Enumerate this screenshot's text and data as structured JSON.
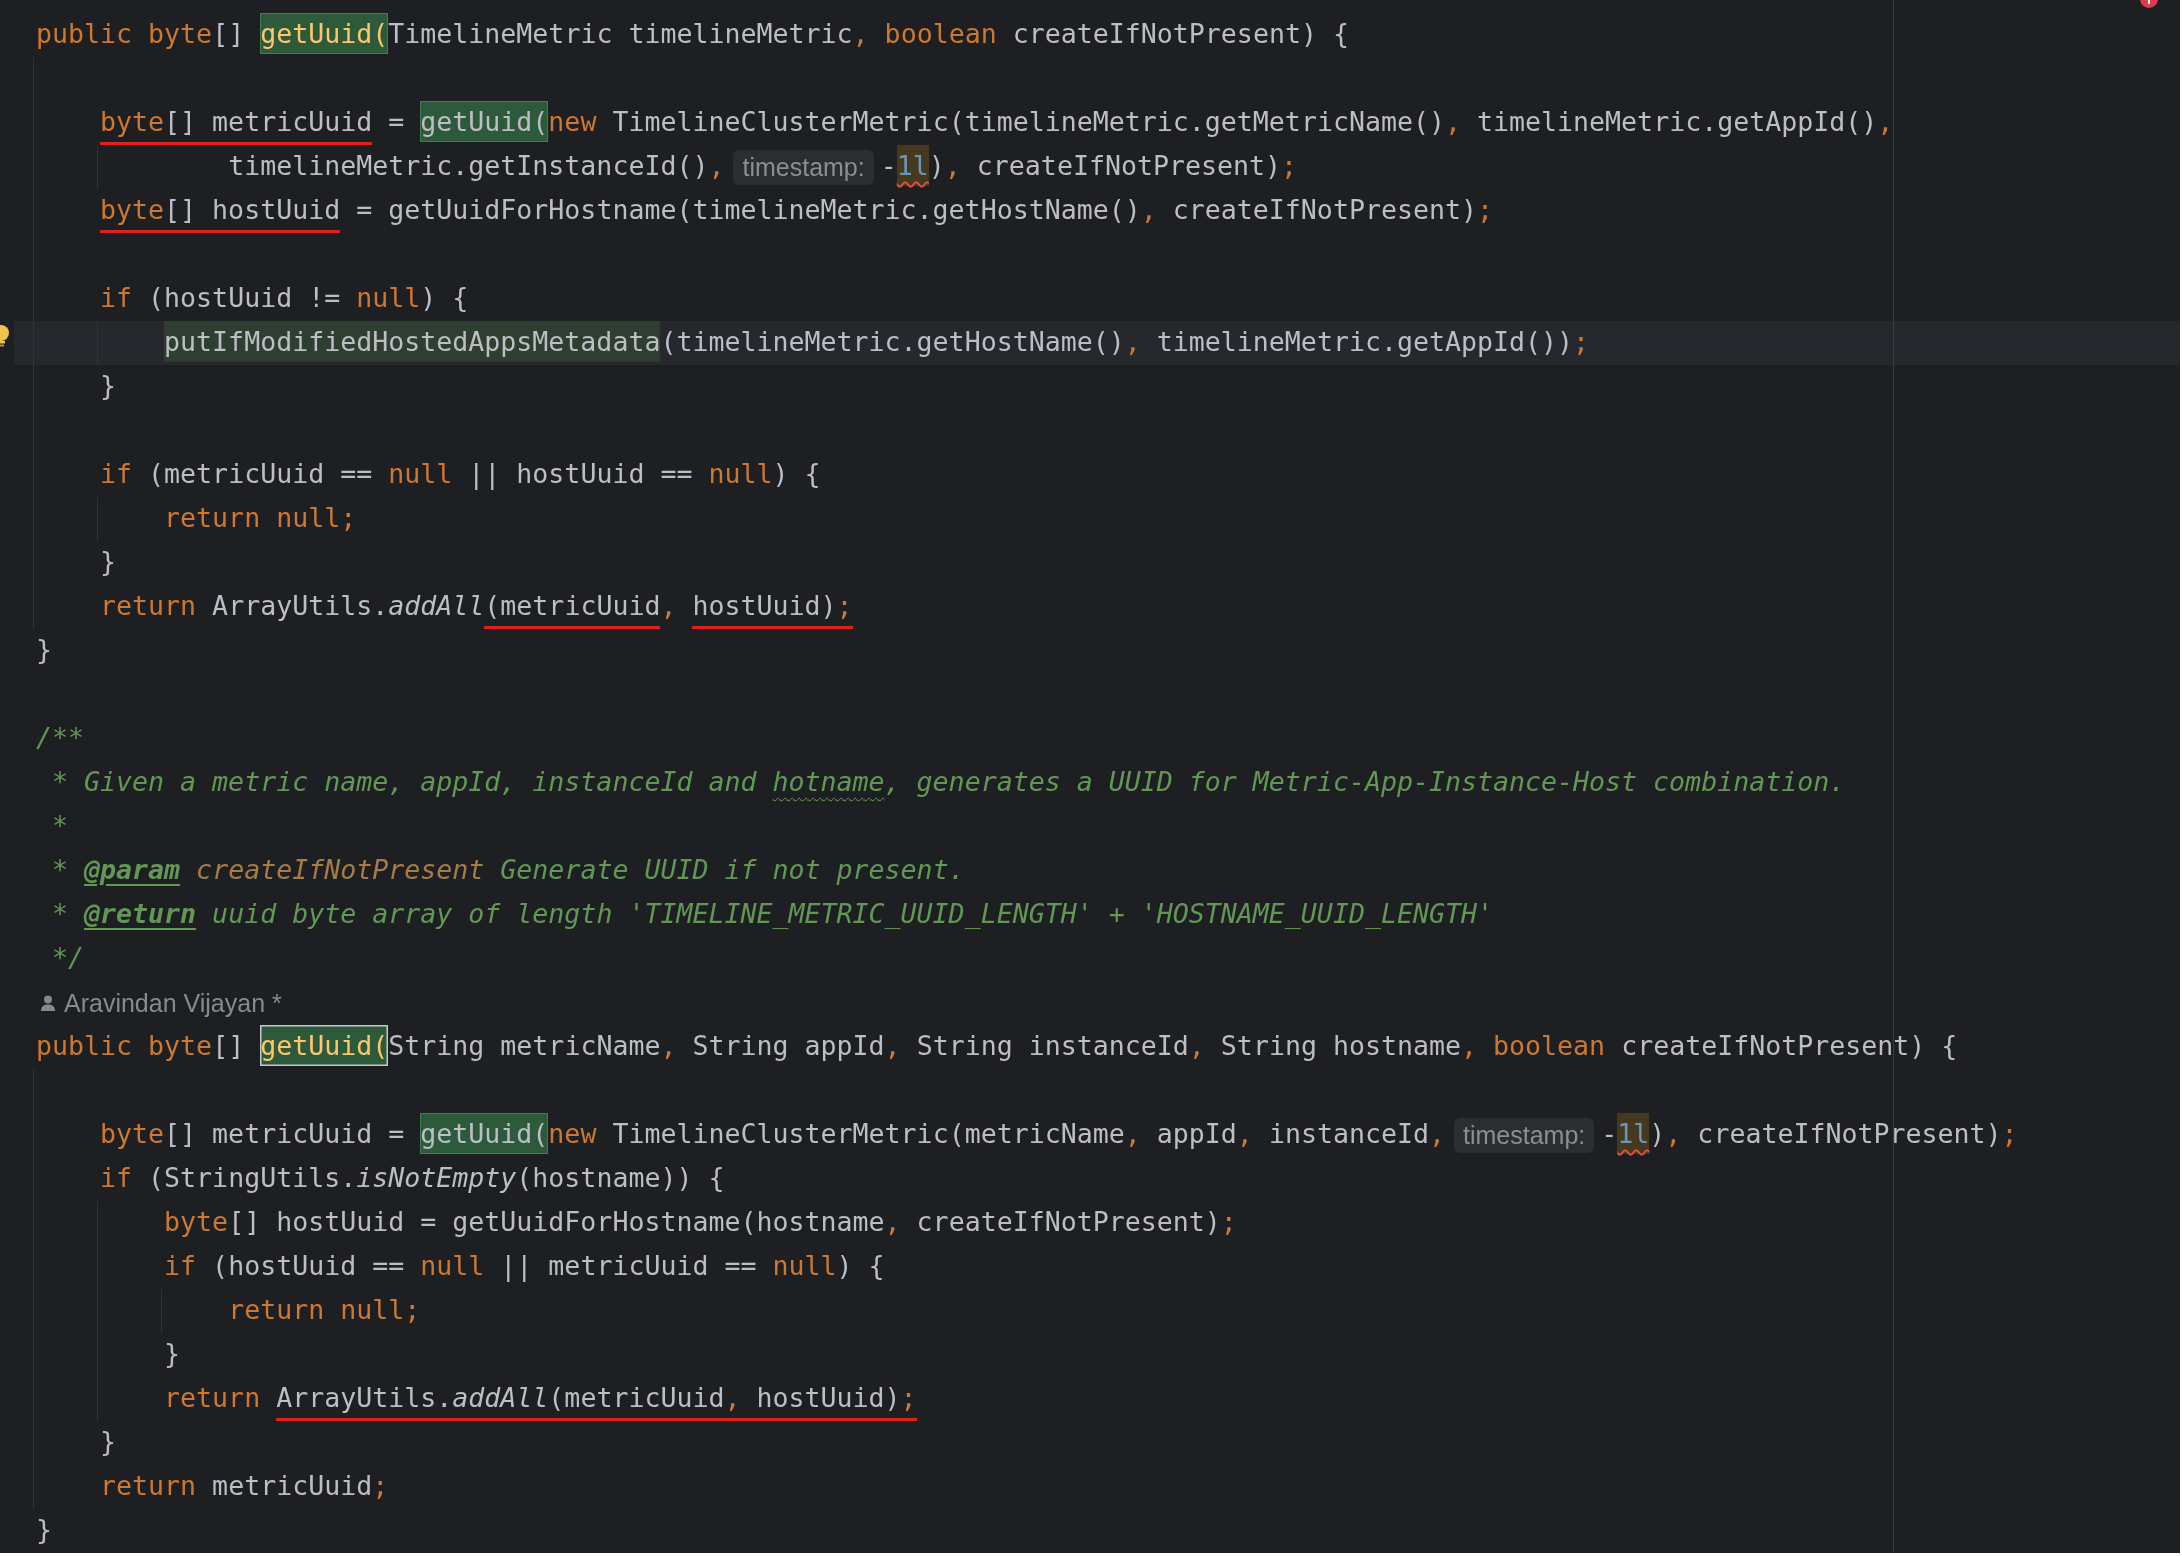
{
  "code_editor": {
    "lines": [
      {
        "kind": "code",
        "current": false,
        "tokens": [
          {
            "kind": "keyword",
            "text": "public byte"
          },
          {
            "kind": "plain",
            "text": "[] "
          },
          {
            "kind": "decl",
            "text": "getUuid(",
            "highlight": {
              "kind": "usage"
            }
          },
          {
            "kind": "plain",
            "text": "TimelineMetric timelineMetric"
          },
          {
            "kind": "punct",
            "text": ","
          },
          {
            "kind": "keyword",
            "text": " boolean"
          },
          {
            "kind": "plain",
            "text": " createIfNotPresent) {"
          }
        ],
        "children": [
          {
            "kind": "blank",
            "current": false
          },
          {
            "kind": "code",
            "current": false,
            "tokens": [
              {
                "kind": "keyword",
                "text": "byte",
                "highlight": {
                  "kind": "annotation"
                }
              },
              {
                "kind": "plain",
                "text": "[] metricUuid",
                "highlight": {
                  "kind": "annotation"
                }
              },
              {
                "kind": "plain",
                "text": " = "
              },
              {
                "kind": "plain",
                "text": "getUuid(",
                "highlight": {
                  "kind": "usage"
                }
              },
              {
                "kind": "keyword",
                "text": "new"
              },
              {
                "kind": "plain",
                "text": " TimelineClusterMetric(timelineMetric.getMetricName()"
              },
              {
                "kind": "punct",
                "text": ","
              },
              {
                "kind": "plain",
                "text": " timelineMetric.getAppId()"
              },
              {
                "kind": "punct",
                "text": ","
              }
            ],
            "children": [
              {
                "kind": "continuation",
                "current": false,
                "tokens": [
                  {
                    "kind": "plain",
                    "text": "timelineMetric.getInstanceId()"
                  },
                  {
                    "kind": "punct",
                    "text": ","
                  },
                  {
                    "kind": "hint",
                    "text": "timestamp:"
                  },
                  {
                    "kind": "plain",
                    "text": "-"
                  },
                  {
                    "kind": "number",
                    "text": "1l",
                    "highlight": {
                      "kind": "warning"
                    }
                  },
                  {
                    "kind": "plain",
                    "text": ")"
                  },
                  {
                    "kind": "punct",
                    "text": ","
                  },
                  {
                    "kind": "plain",
                    "text": " createIfNotPresent)"
                  },
                  {
                    "kind": "punct",
                    "text": ";"
                  }
                ]
              }
            ]
          },
          {
            "kind": "code",
            "current": false,
            "tokens": [
              {
                "kind": "keyword",
                "text": "byte",
                "highlight": {
                  "kind": "annotation"
                }
              },
              {
                "kind": "plain",
                "text": "[] hostUuid",
                "highlight": {
                  "kind": "annotation"
                }
              },
              {
                "kind": "plain",
                "text": " = getUuidForHostname(timelineMetric.getHostName()"
              },
              {
                "kind": "punct",
                "text": ","
              },
              {
                "kind": "plain",
                "text": " createIfNotPresent)"
              },
              {
                "kind": "punct",
                "text": ";"
              }
            ]
          },
          {
            "kind": "blank",
            "current": false
          },
          {
            "kind": "code",
            "current": false,
            "tokens": [
              {
                "kind": "keyword",
                "text": "if"
              },
              {
                "kind": "plain",
                "text": " (hostUuid != "
              },
              {
                "kind": "keyword",
                "text": "null"
              },
              {
                "kind": "plain",
                "text": ") {"
              }
            ],
            "children": [
              {
                "kind": "code",
                "current": true,
                "gutter": {
                  "kind": "bulb"
                },
                "tokens": [
                  {
                    "kind": "plain",
                    "text": "putIfModifiedHostedAppsMetadata",
                    "highlight": {
                      "kind": "inspection"
                    }
                  },
                  {
                    "kind": "plain",
                    "text": "(timelineMetric.getHostName()"
                  },
                  {
                    "kind": "punct",
                    "text": ","
                  },
                  {
                    "kind": "plain",
                    "text": " timelineMetric.getAppId())"
                  },
                  {
                    "kind": "punct",
                    "text": ";"
                  }
                ]
              }
            ]
          },
          {
            "kind": "code",
            "current": false,
            "tokens": [
              {
                "kind": "plain",
                "text": "}"
              }
            ]
          },
          {
            "kind": "blank",
            "current": false
          },
          {
            "kind": "code",
            "current": false,
            "tokens": [
              {
                "kind": "keyword",
                "text": "if"
              },
              {
                "kind": "plain",
                "text": " (metricUuid == "
              },
              {
                "kind": "keyword",
                "text": "null"
              },
              {
                "kind": "plain",
                "text": " || hostUuid == "
              },
              {
                "kind": "keyword",
                "text": "null"
              },
              {
                "kind": "plain",
                "text": ") {"
              }
            ],
            "children": [
              {
                "kind": "code",
                "current": false,
                "tokens": [
                  {
                    "kind": "keyword",
                    "text": "return null;"
                  }
                ]
              }
            ]
          },
          {
            "kind": "code",
            "current": false,
            "tokens": [
              {
                "kind": "plain",
                "text": "}"
              }
            ]
          },
          {
            "kind": "code",
            "current": false,
            "tokens": [
              {
                "kind": "keyword",
                "text": "return"
              },
              {
                "kind": "plain",
                "text": " ArrayUtils."
              },
              {
                "kind": "static",
                "text": "addAll"
              },
              {
                "kind": "plain",
                "text": "(metricUuid",
                "highlight": {
                  "kind": "annotation"
                }
              },
              {
                "kind": "punct",
                "text": ", "
              },
              {
                "kind": "plain",
                "text": "hostUuid)",
                "highlight": {
                  "kind": "annotation"
                }
              },
              {
                "kind": "punct",
                "text": ";",
                "highlight": {
                  "kind": "annotation"
                }
              }
            ]
          }
        ]
      },
      {
        "kind": "code",
        "current": false,
        "tokens": [
          {
            "kind": "plain",
            "text": "}"
          }
        ]
      },
      {
        "kind": "blank",
        "current": false
      },
      {
        "kind": "doc",
        "current": false,
        "tokens": [
          {
            "kind": "doc",
            "text": "/**"
          }
        ]
      },
      {
        "kind": "docbody",
        "current": false,
        "tokens": [
          {
            "kind": "doc",
            "text": "* Given a metric name, appId, instanceId and "
          },
          {
            "kind": "typo",
            "text": "hotname"
          },
          {
            "kind": "doc",
            "text": ", generates a UUID for Metric-App-Instance-Host combination."
          }
        ]
      },
      {
        "kind": "docbody",
        "current": false,
        "tokens": [
          {
            "kind": "doc",
            "text": "*"
          }
        ]
      },
      {
        "kind": "docbody",
        "current": false,
        "tokens": [
          {
            "kind": "doc",
            "text": "* "
          },
          {
            "kind": "tag",
            "text": "@param"
          },
          {
            "kind": "param",
            "text": " createIfNotPresent"
          },
          {
            "kind": "doc",
            "text": " Generate UUID if not present."
          }
        ]
      },
      {
        "kind": "docbody",
        "current": false,
        "tokens": [
          {
            "kind": "doc",
            "text": "* "
          },
          {
            "kind": "tag",
            "text": "@return"
          },
          {
            "kind": "doc",
            "text": " uuid byte array of length 'TIMELINE_METRIC_UUID_LENGTH' + 'HOSTNAME_UUID_LENGTH'"
          }
        ]
      },
      {
        "kind": "docbody",
        "current": false,
        "tokens": [
          {
            "kind": "doc",
            "text": "*/"
          }
        ]
      },
      {
        "kind": "author",
        "current": false,
        "text": "Aravindan Vijayan *"
      },
      {
        "kind": "code",
        "current": false,
        "tokens": [
          {
            "kind": "keyword",
            "text": "public byte"
          },
          {
            "kind": "plain",
            "text": "[] "
          },
          {
            "kind": "decl",
            "text": "getUuid(",
            "highlight": {
              "kind": "caret"
            }
          },
          {
            "kind": "plain",
            "text": "String metricName"
          },
          {
            "kind": "punct",
            "text": ","
          },
          {
            "kind": "plain",
            "text": " String appId"
          },
          {
            "kind": "punct",
            "text": ","
          },
          {
            "kind": "plain",
            "text": " String instanceId"
          },
          {
            "kind": "punct",
            "text": ","
          },
          {
            "kind": "plain",
            "text": " String hostname"
          },
          {
            "kind": "punct",
            "text": ","
          },
          {
            "kind": "keyword",
            "text": " boolean"
          },
          {
            "kind": "plain",
            "text": " createIfNotPresent) {"
          }
        ],
        "children": [
          {
            "kind": "blank",
            "current": false
          },
          {
            "kind": "code",
            "current": false,
            "tokens": [
              {
                "kind": "keyword",
                "text": "byte"
              },
              {
                "kind": "plain",
                "text": "[] metricUuid = "
              },
              {
                "kind": "plain",
                "text": "getUuid(",
                "highlight": {
                  "kind": "usage"
                }
              },
              {
                "kind": "keyword",
                "text": "new"
              },
              {
                "kind": "plain",
                "text": " TimelineClusterMetric(metricName"
              },
              {
                "kind": "punct",
                "text": ","
              },
              {
                "kind": "plain",
                "text": " appId"
              },
              {
                "kind": "punct",
                "text": ","
              },
              {
                "kind": "plain",
                "text": " instanceId"
              },
              {
                "kind": "punct",
                "text": ","
              },
              {
                "kind": "hint",
                "text": "timestamp:"
              },
              {
                "kind": "plain",
                "text": "-"
              },
              {
                "kind": "number",
                "text": "1l",
                "highlight": {
                  "kind": "warning"
                }
              },
              {
                "kind": "plain",
                "text": ")"
              },
              {
                "kind": "punct",
                "text": ","
              },
              {
                "kind": "plain",
                "text": " createIfNotPresent)"
              },
              {
                "kind": "punct",
                "text": ";"
              }
            ]
          },
          {
            "kind": "code",
            "current": false,
            "tokens": [
              {
                "kind": "keyword",
                "text": "if"
              },
              {
                "kind": "plain",
                "text": " (StringUtils."
              },
              {
                "kind": "static",
                "text": "isNotEmpty"
              },
              {
                "kind": "plain",
                "text": "(hostname)) {"
              }
            ],
            "children": [
              {
                "kind": "code",
                "current": false,
                "tokens": [
                  {
                    "kind": "keyword",
                    "text": "byte"
                  },
                  {
                    "kind": "plain",
                    "text": "[] hostUuid = getUuidForHostname(hostname"
                  },
                  {
                    "kind": "punct",
                    "text": ","
                  },
                  {
                    "kind": "plain",
                    "text": " createIfNotPresent)"
                  },
                  {
                    "kind": "punct",
                    "text": ";"
                  }
                ]
              },
              {
                "kind": "code",
                "current": false,
                "tokens": [
                  {
                    "kind": "keyword",
                    "text": "if"
                  },
                  {
                    "kind": "plain",
                    "text": " (hostUuid == "
                  },
                  {
                    "kind": "keyword",
                    "text": "null"
                  },
                  {
                    "kind": "plain",
                    "text": " || metricUuid == "
                  },
                  {
                    "kind": "keyword",
                    "text": "null"
                  },
                  {
                    "kind": "plain",
                    "text": ") {"
                  }
                ],
                "children": [
                  {
                    "kind": "code",
                    "current": false,
                    "tokens": [
                      {
                        "kind": "keyword",
                        "text": "return null;"
                      }
                    ]
                  }
                ]
              },
              {
                "kind": "code",
                "current": false,
                "tokens": [
                  {
                    "kind": "plain",
                    "text": "}"
                  }
                ]
              },
              {
                "kind": "code",
                "current": false,
                "tokens": [
                  {
                    "kind": "keyword",
                    "text": "return "
                  },
                  {
                    "kind": "plain",
                    "text": "ArrayUtils.",
                    "highlight": {
                      "kind": "annotation"
                    }
                  },
                  {
                    "kind": "static",
                    "text": "addAll",
                    "highlight": {
                      "kind": "annotation"
                    }
                  },
                  {
                    "kind": "plain",
                    "text": "(metricUuid",
                    "highlight": {
                      "kind": "annotation"
                    }
                  },
                  {
                    "kind": "punct",
                    "text": ",",
                    "highlight": {
                      "kind": "annotation"
                    }
                  },
                  {
                    "kind": "plain",
                    "text": " hostUuid)",
                    "highlight": {
                      "kind": "annotation"
                    }
                  },
                  {
                    "kind": "punct",
                    "text": ";",
                    "highlight": {
                      "kind": "annotation"
                    }
                  }
                ]
              }
            ]
          },
          {
            "kind": "code",
            "current": false,
            "tokens": [
              {
                "kind": "plain",
                "text": "}"
              }
            ]
          },
          {
            "kind": "code",
            "current": false,
            "tokens": [
              {
                "kind": "keyword",
                "text": "return"
              },
              {
                "kind": "plain",
                "text": " metricUuid"
              },
              {
                "kind": "punct",
                "text": ";"
              }
            ]
          }
        ]
      },
      {
        "kind": "code",
        "current": false,
        "tokens": [
          {
            "kind": "plain",
            "text": "}"
          }
        ]
      }
    ]
  }
}
